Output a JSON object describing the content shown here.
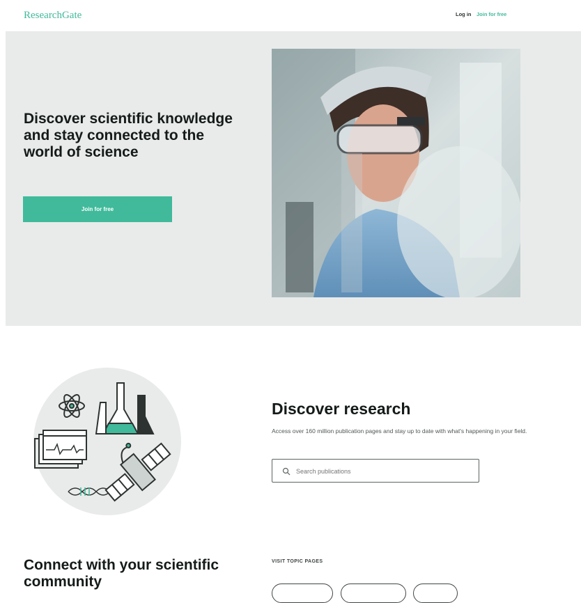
{
  "header": {
    "logo": "ResearchGate",
    "login_label": "Log in",
    "join_label": "Join for free"
  },
  "hero": {
    "title": "Discover scientific knowledge and stay connected to the world of science",
    "join_button": "Join for free"
  },
  "discover": {
    "title": "Discover research",
    "description": "Access over 160 million publication pages and stay up to date with what's happening in your field.",
    "search_placeholder": "Search publications"
  },
  "connect": {
    "title": "Connect with your scientific community",
    "visit_label": "VISIT TOPIC PAGES"
  },
  "colors": {
    "brand": "#40ba9b",
    "hero_background": "#e9ebea",
    "text_dark": "#141b18"
  }
}
